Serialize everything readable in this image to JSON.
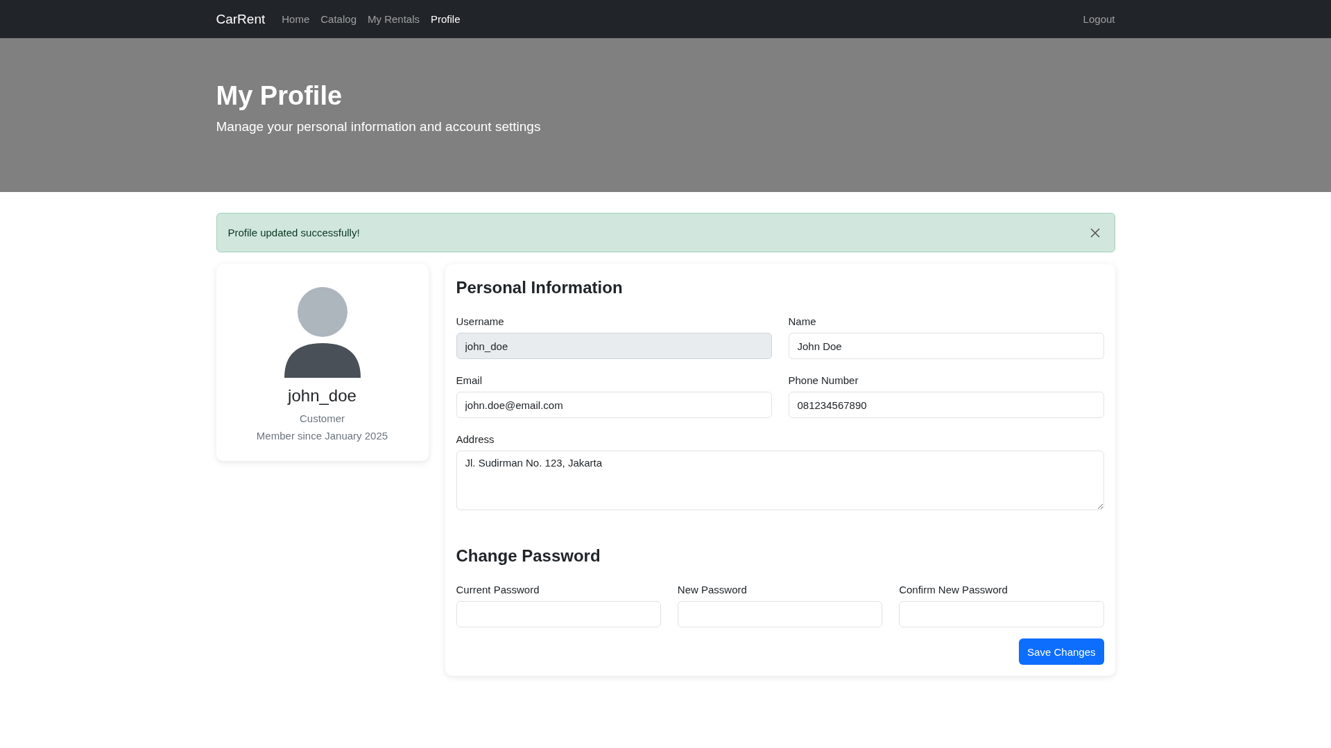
{
  "navbar": {
    "brand": "CarRent",
    "links": [
      {
        "label": "Home",
        "selected": false
      },
      {
        "label": "Catalog",
        "selected": false
      },
      {
        "label": "My Rentals",
        "selected": false
      },
      {
        "label": "Profile",
        "selected": true
      }
    ],
    "logout": "Logout"
  },
  "hero": {
    "title": "My Profile",
    "subtitle": "Manage your personal information and account settings"
  },
  "alert": {
    "message": "Profile updated successfully!"
  },
  "profile_card": {
    "username": "john_doe",
    "role": "Customer",
    "member_since": "Member since January 2025"
  },
  "personal": {
    "title": "Personal Information",
    "fields": [
      {
        "kind": "input",
        "label": "Username",
        "value": "john_doe",
        "disabled": true
      },
      {
        "kind": "input",
        "label": "Name",
        "value": "John Doe",
        "disabled": false
      },
      {
        "kind": "input",
        "label": "Email",
        "value": "john.doe@email.com",
        "disabled": false
      },
      {
        "kind": "input",
        "label": "Phone Number",
        "value": "081234567890",
        "disabled": false
      },
      {
        "kind": "textarea",
        "label": "Address",
        "value": "Jl. Sudirman No. 123, Jakarta",
        "disabled": false
      }
    ]
  },
  "password": {
    "title": "Change Password",
    "fields": [
      {
        "label": "Current Password"
      },
      {
        "label": "New Password"
      },
      {
        "label": "Confirm New Password"
      }
    ]
  },
  "save_button": "Save Changes"
}
